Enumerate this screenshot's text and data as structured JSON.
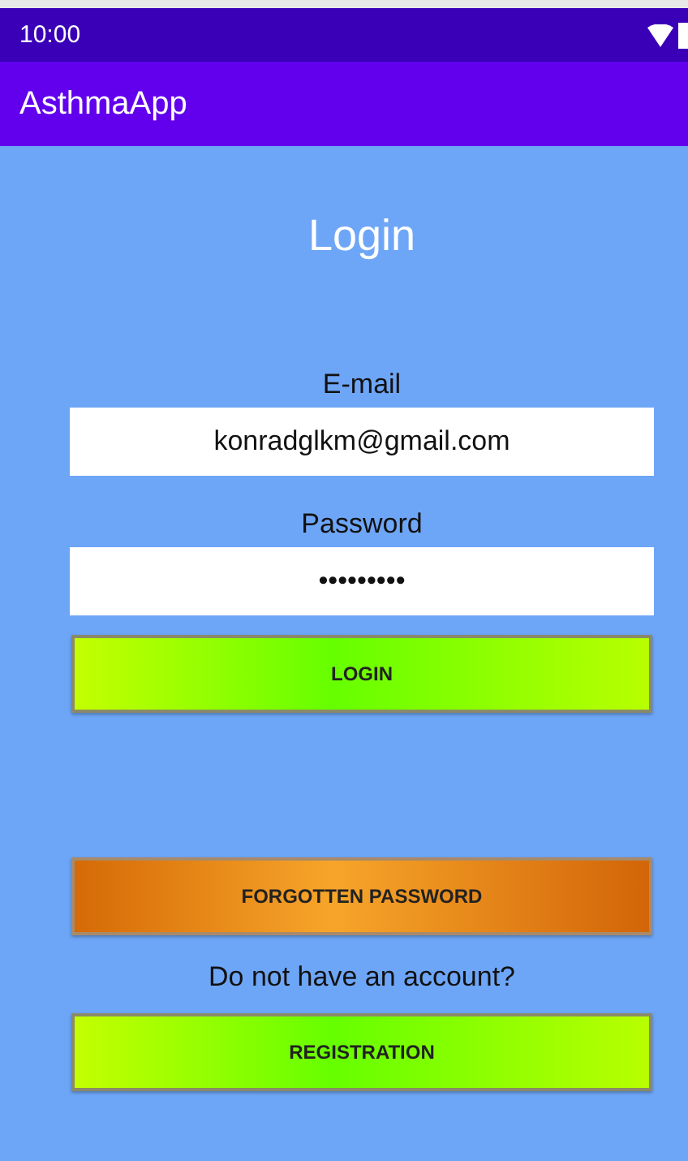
{
  "status_bar": {
    "time": "10:00"
  },
  "app_bar": {
    "title": "AsthmaApp"
  },
  "heading": "Login",
  "fields": [
    {
      "label": "E-mail",
      "value": "konradglkm@gmail.com"
    },
    {
      "label": "Password",
      "value": "•••••••••"
    }
  ],
  "login_button": {
    "label": "LOGIN",
    "kind": "green"
  },
  "forgot_button": {
    "label": "FORGOTTEN PASSWORD",
    "kind": "orange"
  },
  "account_prompt": "Do not have an account?",
  "register_button": {
    "label": "REGISTRATION",
    "kind": "green"
  }
}
